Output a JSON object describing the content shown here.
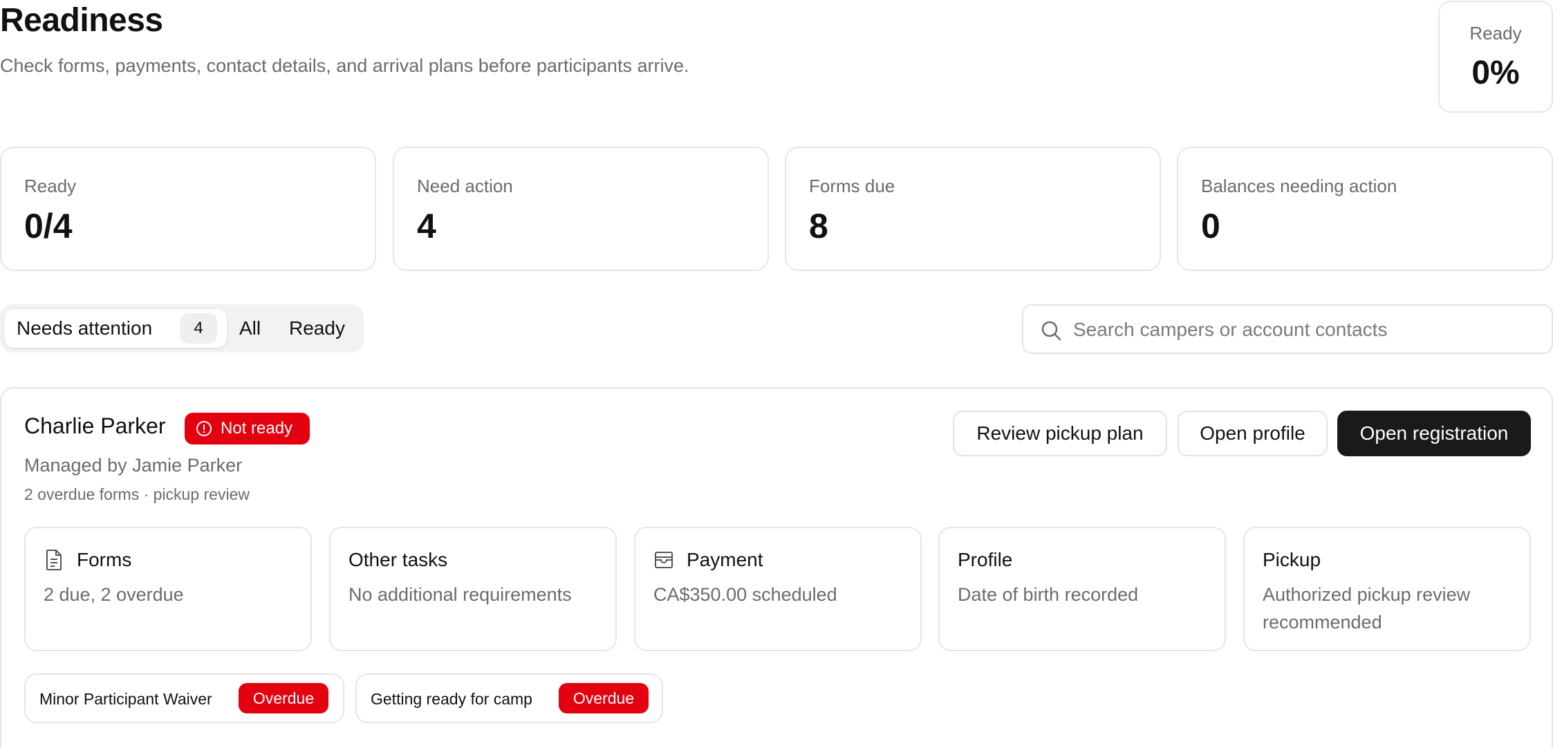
{
  "header": {
    "title": "Readiness",
    "subtitle": "Check forms, payments, contact details, and arrival plans before participants arrive.",
    "ready_label": "Ready",
    "ready_percent": "0%"
  },
  "stats": [
    {
      "label": "Ready",
      "value": "0/4"
    },
    {
      "label": "Need action",
      "value": "4"
    },
    {
      "label": "Forms due",
      "value": "8"
    },
    {
      "label": "Balances needing action",
      "value": "0"
    }
  ],
  "filters": {
    "needs_attention_label": "Needs attention",
    "needs_attention_count": "4",
    "all_label": "All",
    "ready_label": "Ready",
    "active": "Needs attention"
  },
  "search": {
    "placeholder": "Search campers or account contacts",
    "value": ""
  },
  "camper": {
    "name": "Charlie Parker",
    "status": "Not ready",
    "managed_by": "Managed by Jamie Parker",
    "summary": "2 overdue forms · pickup review",
    "actions": {
      "review_pickup": "Review pickup plan",
      "open_profile": "Open profile",
      "open_registration": "Open registration"
    },
    "tiles": [
      {
        "title": "Forms",
        "body": "2 due, 2 overdue",
        "icon": "document-icon"
      },
      {
        "title": "Other tasks",
        "body": "No additional requirements"
      },
      {
        "title": "Payment",
        "body": "CA$350.00 scheduled",
        "icon": "wallet-icon"
      },
      {
        "title": "Profile",
        "body": "Date of birth recorded"
      },
      {
        "title": "Pickup",
        "body": "Authorized pickup review recommended"
      }
    ],
    "forms": [
      {
        "name": "Minor Participant Waiver",
        "status": "Overdue"
      },
      {
        "name": "Getting ready for camp",
        "status": "Overdue"
      }
    ]
  },
  "colors": {
    "danger": "#e3000f",
    "primary_button": "#1a1a1a",
    "muted_text": "#6b6b6b",
    "border": "#e6e6e6"
  }
}
